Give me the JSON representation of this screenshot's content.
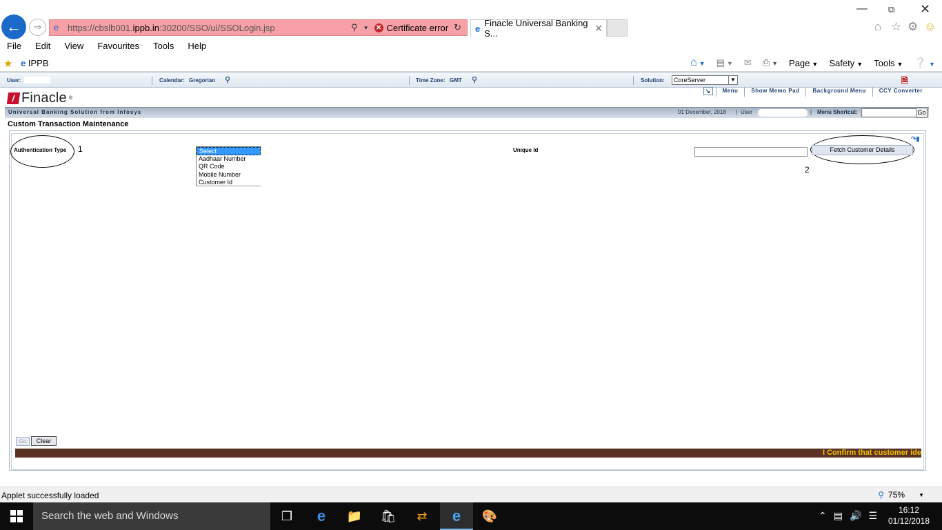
{
  "browser": {
    "url_prefix": "https://cbslb001.",
    "url_host": "ippb.in",
    "url_suffix": ":30200/SSO/ui/SSOLogin.jsp",
    "cert_error": "Certificate error",
    "tab_title": "Finacle Universal Banking S...",
    "menu": [
      "File",
      "Edit",
      "View",
      "Favourites",
      "Tools",
      "Help"
    ],
    "favourite": "IPPB",
    "commands": {
      "page": "Page",
      "safety": "Safety",
      "tools": "Tools"
    }
  },
  "finacle": {
    "user_label": "User:",
    "calendar_label": "Calendar:",
    "calendar_value": "Gregorian",
    "timezone_label": "Time Zone:",
    "timezone_value": "GMT",
    "solution_label": "Solution:",
    "solution_value": "CoreServer",
    "logo": "Finacle",
    "top_menu": {
      "menu": "Menu",
      "memo": "Show Memo Pad",
      "background": "Background Menu",
      "ccy": "CCY Converter"
    },
    "tagline": "Universal Banking Solution from Infosys",
    "date": "01 December, 2018",
    "user_text": "User",
    "menu_shortcut_label": "Menu Shortcut:",
    "shortcut_go": "Go",
    "page_title": "Custom Transaction Maintenance",
    "auth_label": "Authentication Type",
    "annotation_1": "1",
    "annotation_2": "2",
    "auth_options": [
      "Select",
      "Aadhaar Number",
      "QR Code",
      "Mobile Number",
      "Customer Id"
    ],
    "unique_id_label": "Unique Id",
    "unique_id_value": "",
    "fetch_button": "Fetch Customer Details",
    "go_button": "Go",
    "clear_button": "Clear",
    "ticker": "I Confirm that customer ide"
  },
  "status": {
    "message": "Applet successfully loaded",
    "zoom": "75%"
  },
  "taskbar": {
    "search_placeholder": "Search the web and Windows",
    "time": "16:12",
    "date": "01/12/2018"
  },
  "colors": {
    "address_error": "#f7a0a7",
    "ticker_bg": "#5a3224",
    "ticker_text": "#f2c400",
    "finacle_navy": "#1d3f70"
  }
}
